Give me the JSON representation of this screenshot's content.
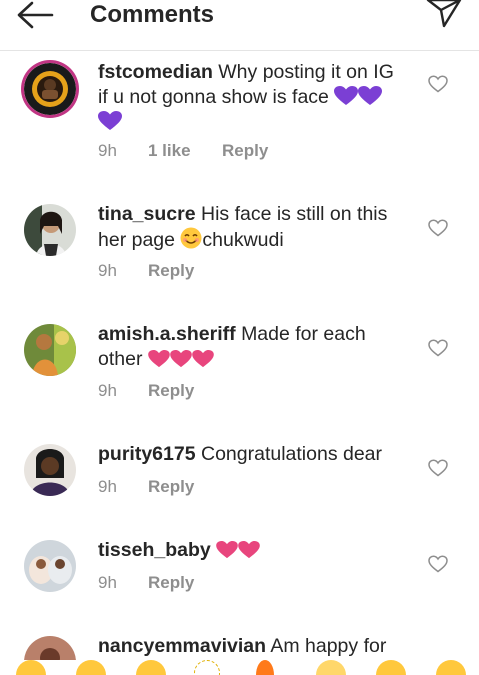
{
  "header": {
    "title": "Comments",
    "back_icon": "arrow-left-icon",
    "send_icon": "paper-plane-icon"
  },
  "comments": [
    {
      "username": "fstcomedian",
      "text": "Why posting it on IG if u not gonna show is face",
      "emojis": [
        "purple-heart",
        "purple-heart",
        "purple-heart"
      ],
      "time": "9h",
      "likes": "1 like",
      "reply": "Reply"
    },
    {
      "username": "tina_sucre",
      "text_before": "His face is still on this her page",
      "emoji": "smiling-face",
      "text_after": "chukwudi",
      "time": "9h",
      "reply": "Reply"
    },
    {
      "username": "amish.a.sheriff",
      "text": "Made for each other",
      "emojis": [
        "pink-heart",
        "pink-heart",
        "pink-heart"
      ],
      "time": "9h",
      "reply": "Reply"
    },
    {
      "username": "purity6175",
      "text": "Congratulations dear",
      "time": "9h",
      "reply": "Reply"
    },
    {
      "username": "tisseh_baby",
      "text": "",
      "emojis": [
        "pink-heart",
        "pink-heart"
      ],
      "time": "9h",
      "reply": "Reply"
    },
    {
      "username": "nancyemmavivian",
      "text": "Am happy for"
    }
  ],
  "colors": {
    "purple_heart": "#7b3fd4",
    "pink_heart": "#e8457d",
    "meta_gray": "#8e8e8e",
    "text": "#262626"
  },
  "emoji_bar": [
    "grinning",
    "heart-eyes",
    "laughing",
    "sparkle",
    "fire",
    "clapping",
    "crying",
    "wow"
  ]
}
